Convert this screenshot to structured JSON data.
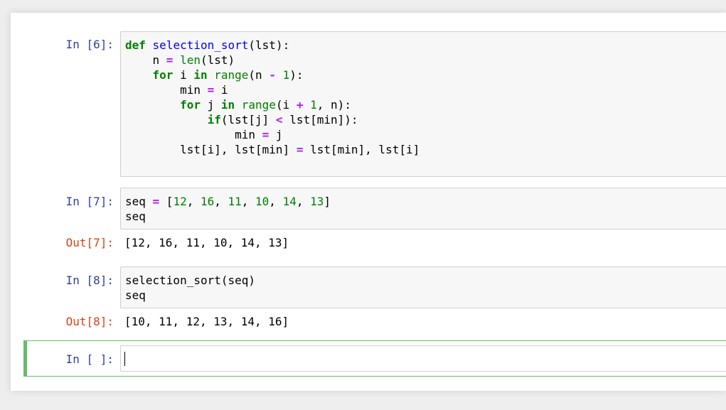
{
  "cells": [
    {
      "prompt": "In [6]:",
      "code": "def selection_sort(lst):\n    n = len(lst)\n    for i in range(n - 1):\n        min = i\n        for j in range(i + 1, n):\n            if(lst[j] < lst[min]):\n                min = j\n        lst[i], lst[min] = lst[min], lst[i]"
    },
    {
      "prompt": "In [7]:",
      "code": "seq = [12, 16, 11, 10, 14, 13]\nseq",
      "out_prompt": "Out[7]:",
      "output": "[12, 16, 11, 10, 14, 13]"
    },
    {
      "prompt": "In [8]:",
      "code": "selection_sort(seq)\nseq",
      "out_prompt": "Out[8]:",
      "output": "[10, 11, 12, 13, 14, 16]"
    },
    {
      "prompt": "In [ ]:",
      "code": ""
    }
  ],
  "colors": {
    "keyword": "#008000",
    "function_name": "#0000ff",
    "operator": "#aa22ff",
    "number": "#008000",
    "in_prompt": "#303f9f",
    "out_prompt": "#d84315",
    "selected_cell_border": "#66bb6a"
  }
}
